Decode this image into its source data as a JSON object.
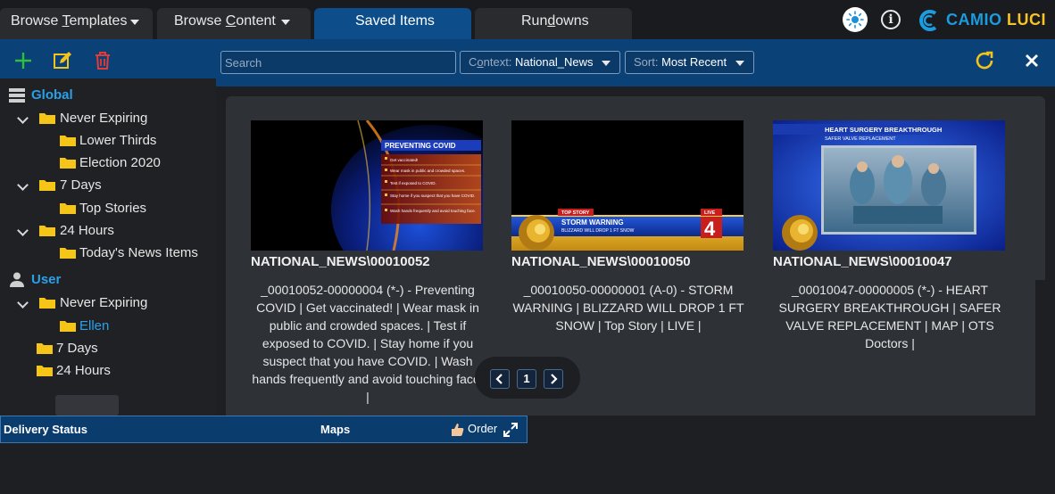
{
  "tabs": [
    {
      "label_pre": "Browse ",
      "label_u": "T",
      "label_post": "emplates"
    },
    {
      "label_pre": "Browse ",
      "label_u": "C",
      "label_post": "ontent"
    },
    {
      "label": "Saved Items"
    },
    {
      "label_pre": "Run",
      "label_u": "d",
      "label_post": "owns"
    }
  ],
  "brand": {
    "part1": "CAMIO ",
    "part2": "LUCI",
    "color1": "#1b9be0",
    "color2": "#f7c325"
  },
  "toolbar": {
    "search_placeholder": "Search",
    "context_key_pre": "C",
    "context_key_u": "o",
    "context_key_post": "ntext:",
    "context_value": "National_News",
    "sort_key": "Sort:",
    "sort_value": "Most Recent"
  },
  "tree": {
    "global_label": "Global",
    "user_label": "User",
    "global_items": [
      "Never Expiring",
      "Lower Thirds",
      "Election 2020",
      "7 Days",
      "Top Stories",
      "24 Hours",
      "Today's News Items"
    ],
    "user_items": [
      "Never Expiring",
      "Ellen",
      "7 Days",
      "24 Hours"
    ]
  },
  "cards": [
    {
      "title": "NATIONAL_NEWS\\00010052",
      "desc": "_00010052-00000004 (*-) - Preventing COVID | Get vaccinated! | Wear mask in public and crowded spaces. | Test if exposed to COVID. | Stay home if you suspect that you have COVID. | Wash hands frequently and avoid touching face. |",
      "thumb_heading": "PREVENTING COVID",
      "thumb_lines": [
        "Get vaccinated!",
        "Wear mask in public and crowded spaces.",
        "Test if exposed to COVID.",
        "Stay home if you suspect that you have COVID.",
        "Wash hands frequently and avoid touching face."
      ]
    },
    {
      "title": "NATIONAL_NEWS\\00010050",
      "desc": "_00010050-00000001 (A-0) - STORM WARNING | BLIZZARD WILL DROP 1 FT SNOW | Top Story | LIVE |",
      "thumb_tag": "TOP STORY",
      "thumb_heading": "STORM WARNING",
      "thumb_sub": "BLIZZARD WILL DROP 1 FT SNOW",
      "thumb_live": "LIVE",
      "thumb_num": "4"
    },
    {
      "title": "NATIONAL_NEWS\\00010047",
      "desc": "_00010047-00000005 (*-) - HEART SURGERY BREAKTHROUGH | SAFER VALVE REPLACEMENT | MAP | OTS Doctors |",
      "thumb_heading": "HEART SURGERY BREAKTHROUGH",
      "thumb_sub": "SAFER VALVE REPLACEMENT"
    }
  ],
  "pager": {
    "current": "1"
  },
  "bottom": {
    "delivery": "Delivery Status",
    "maps": "Maps",
    "order": "Order"
  }
}
